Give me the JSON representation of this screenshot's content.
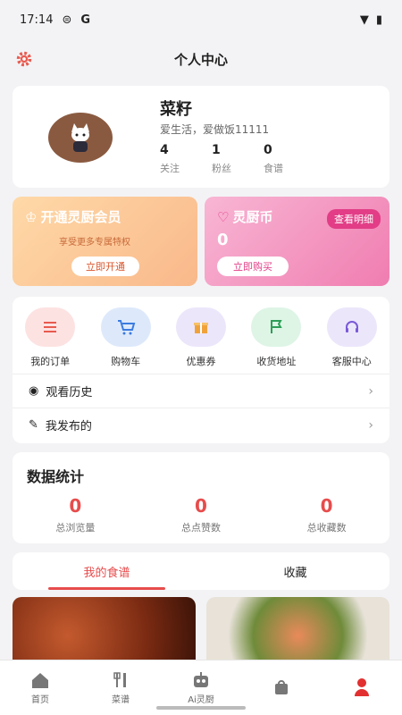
{
  "status": {
    "time": "17:14",
    "g": "G"
  },
  "header": {
    "title": "个人中心"
  },
  "profile": {
    "name": "菜籽",
    "bio": "爱生活，爱做饭11111",
    "stats": [
      {
        "num": "4",
        "label": "关注"
      },
      {
        "num": "1",
        "label": "粉丝"
      },
      {
        "num": "0",
        "label": "食谱"
      }
    ]
  },
  "vip": {
    "title": "开通灵厨会员",
    "subtitle": "享受更多专属特权",
    "button": "立即开通"
  },
  "coin": {
    "title": "灵厨币",
    "value": "0",
    "detail": "查看明细",
    "button": "立即购买"
  },
  "services": [
    {
      "label": "我的订单",
      "icon": "order-icon"
    },
    {
      "label": "购物车",
      "icon": "cart-icon"
    },
    {
      "label": "优惠券",
      "icon": "coupon-icon"
    },
    {
      "label": "收货地址",
      "icon": "flag-icon"
    },
    {
      "label": "客服中心",
      "icon": "headset-icon"
    }
  ],
  "list": [
    {
      "label": "观看历史",
      "icon": "eye-icon"
    },
    {
      "label": "我发布的",
      "icon": "edit-icon"
    }
  ],
  "data_stats": {
    "title": "数据统计",
    "items": [
      {
        "num": "0",
        "label": "总浏览量"
      },
      {
        "num": "0",
        "label": "总点赞数"
      },
      {
        "num": "0",
        "label": "总收藏数"
      }
    ]
  },
  "tabs": [
    {
      "label": "我的食谱"
    },
    {
      "label": "收藏"
    }
  ],
  "tabbar": [
    {
      "label": "首页",
      "icon": "home-icon"
    },
    {
      "label": "菜谱",
      "icon": "utensils-icon"
    },
    {
      "label": "Ai灵厨",
      "icon": "robot-icon"
    },
    {
      "label": "",
      "icon": "bag-icon"
    },
    {
      "label": "",
      "icon": "profile-icon"
    }
  ],
  "colors": {
    "accent": "#e74c4c",
    "coin_pink": "#e23d86",
    "vip_orange": "#f9b88a"
  }
}
